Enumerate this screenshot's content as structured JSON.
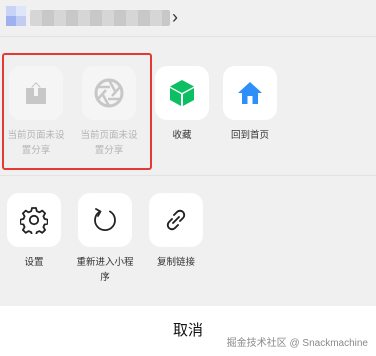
{
  "header": {
    "app_name": "",
    "chevron": "›"
  },
  "menu_row1": [
    {
      "label": "当前页面未设置分享",
      "icon": "share-icon",
      "disabled": true
    },
    {
      "label": "当前页面未设置分享",
      "icon": "aperture-icon",
      "disabled": true
    },
    {
      "label": "收藏",
      "icon": "favorite-cube-icon",
      "disabled": false
    },
    {
      "label": "回到首页",
      "icon": "home-icon",
      "disabled": false
    }
  ],
  "menu_row2": [
    {
      "label": "设置",
      "icon": "gear-icon",
      "disabled": false
    },
    {
      "label": "重新进入小程序",
      "icon": "refresh-icon",
      "disabled": false
    },
    {
      "label": "复制链接",
      "icon": "link-icon",
      "disabled": false
    }
  ],
  "footer": {
    "cancel_label": "取消",
    "watermark": "掘金技术社区 @ Snackmachine"
  },
  "colors": {
    "highlight_border": "#e53935",
    "favorite_green": "#0bbf62",
    "home_blue": "#2f8ff8",
    "disabled_icon": "#c7c7c7"
  }
}
